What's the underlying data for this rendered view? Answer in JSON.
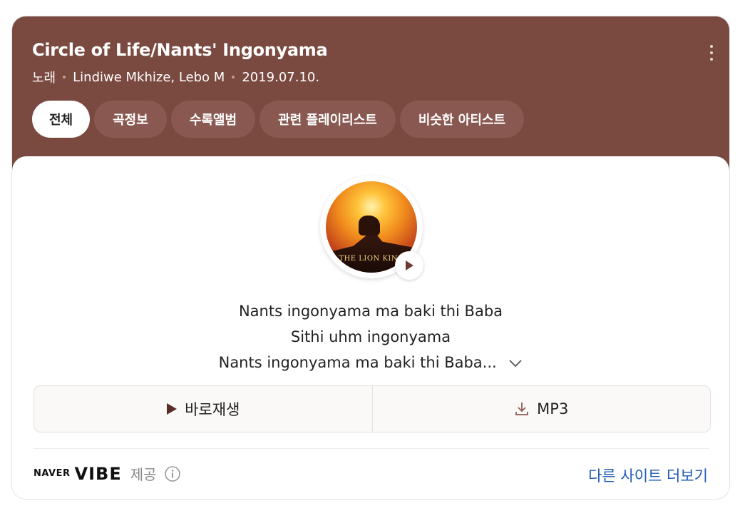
{
  "song": {
    "title": "Circle of Life/Nants' Ingonyama",
    "type": "노래",
    "artists": "Lindiwe Mkhize, Lebo M",
    "date": "2019.07.10."
  },
  "tabs": [
    "전체",
    "곡정보",
    "수록앨범",
    "관련 플레이리스트",
    "비슷한 아티스트"
  ],
  "album_cover": {
    "text": "THE LION KING",
    "icon": "album-cover"
  },
  "lyrics": [
    "Nants ingonyama ma baki thi Baba",
    "Sithi uhm ingonyama",
    "Nants ingonyama ma baki thi Baba..."
  ],
  "actions": {
    "play_label": "바로재생",
    "mp3_label": "MP3"
  },
  "footer": {
    "naver": "NAVER",
    "vibe": "VIBE",
    "provided": "제공",
    "more_link": "다른 사이트 더보기"
  },
  "colors": {
    "header_bg": "#7a4a40",
    "tab_bg": "#895951",
    "link": "#1f5bb5"
  }
}
